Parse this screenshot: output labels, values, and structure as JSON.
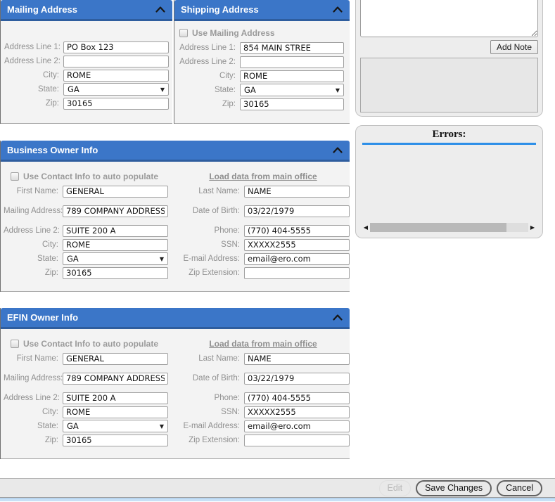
{
  "colors": {
    "section_header_blue": "#3b76c8",
    "section_header_border_blue": "#2e5d9e",
    "errors_rule_blue": "#2d8fe8",
    "footer_strip_blue": "#c7e0f6"
  },
  "mailing_address": {
    "title": "Mailing Address",
    "fields": [
      {
        "label": "Address Line 1:",
        "value": "PO Box 123"
      },
      {
        "label": "Address Line 2:",
        "value": ""
      },
      {
        "label": "City:",
        "value": "ROME"
      },
      {
        "label": "State:",
        "value": "GA",
        "type": "select"
      },
      {
        "label": "Zip:",
        "value": "30165"
      }
    ]
  },
  "shipping_address": {
    "title": "Shipping Address",
    "checkbox_label": "Use Mailing Address",
    "fields": [
      {
        "label": "Address Line 1:",
        "value": "854 MAIN STREE"
      },
      {
        "label": "Address Line 2:",
        "value": ""
      },
      {
        "label": "City:",
        "value": "ROME"
      },
      {
        "label": "State:",
        "value": "GA",
        "type": "select"
      },
      {
        "label": "Zip:",
        "value": "30165"
      }
    ]
  },
  "business_owner": {
    "title": "Business Owner Info",
    "checkbox_label": "Use Contact Info to auto populate",
    "link_label": "Load data from main office",
    "left_fields": [
      {
        "label": "First Name:",
        "value": "GENERAL"
      },
      {
        "label": "Mailing Address:",
        "value": "789 COMPANY ADDRESS"
      },
      {
        "label": "Address Line 2:",
        "value": "SUITE 200 A"
      },
      {
        "label": "City:",
        "value": "ROME"
      },
      {
        "label": "State:",
        "value": "GA",
        "type": "select"
      },
      {
        "label": "Zip:",
        "value": "30165"
      }
    ],
    "right_fields": [
      {
        "label": "Last Name:",
        "value": "NAME"
      },
      {
        "label": "Date of Birth:",
        "value": "03/22/1979"
      },
      {
        "label": "Phone:",
        "value": "(770) 404-5555"
      },
      {
        "label": "SSN:",
        "value": "XXXXX2555"
      },
      {
        "label": "E-mail Address:",
        "value": "email@ero.com"
      },
      {
        "label": "Zip Extension:",
        "value": ""
      }
    ]
  },
  "efin_owner": {
    "title": "EFIN Owner Info",
    "checkbox_label": "Use Contact Info to auto populate",
    "link_label": "Load data from main office",
    "left_fields": [
      {
        "label": "First Name:",
        "value": "GENERAL"
      },
      {
        "label": "Mailing Address:",
        "value": "789 COMPANY ADDRESS"
      },
      {
        "label": "Address Line 2:",
        "value": "SUITE 200 A"
      },
      {
        "label": "City:",
        "value": "ROME"
      },
      {
        "label": "State:",
        "value": "GA",
        "type": "select"
      },
      {
        "label": "Zip:",
        "value": "30165"
      }
    ],
    "right_fields": [
      {
        "label": "Last Name:",
        "value": "NAME"
      },
      {
        "label": "Date of Birth:",
        "value": "03/22/1979"
      },
      {
        "label": "Phone:",
        "value": "(770) 404-5555"
      },
      {
        "label": "SSN:",
        "value": "XXXXX2555"
      },
      {
        "label": "E-mail Address:",
        "value": "email@ero.com"
      },
      {
        "label": "Zip Extension:",
        "value": ""
      }
    ]
  },
  "notes": {
    "note_input_value": "",
    "add_note_label": "Add Note"
  },
  "errors": {
    "title": "Errors:"
  },
  "footer": {
    "edit_label": "Edit",
    "save_label": "Save Changes",
    "cancel_label": "Cancel"
  }
}
